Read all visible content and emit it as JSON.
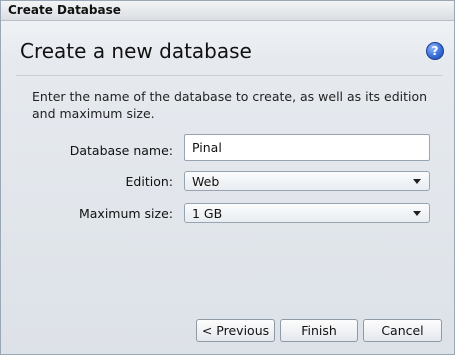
{
  "window": {
    "title": "Create Database"
  },
  "heading": "Create a new database",
  "help": {
    "glyph": "?",
    "color": "#3a6fd8"
  },
  "description": "Enter the name of the database to create, as well as its edition and maximum size.",
  "form": {
    "database_name": {
      "label": "Database name:",
      "value": "Pinal"
    },
    "edition": {
      "label": "Edition:",
      "selected": "Web"
    },
    "maximum_size": {
      "label": "Maximum size:",
      "selected": "1 GB"
    }
  },
  "buttons": {
    "previous": "< Previous",
    "finish": "Finish",
    "cancel": "Cancel"
  }
}
